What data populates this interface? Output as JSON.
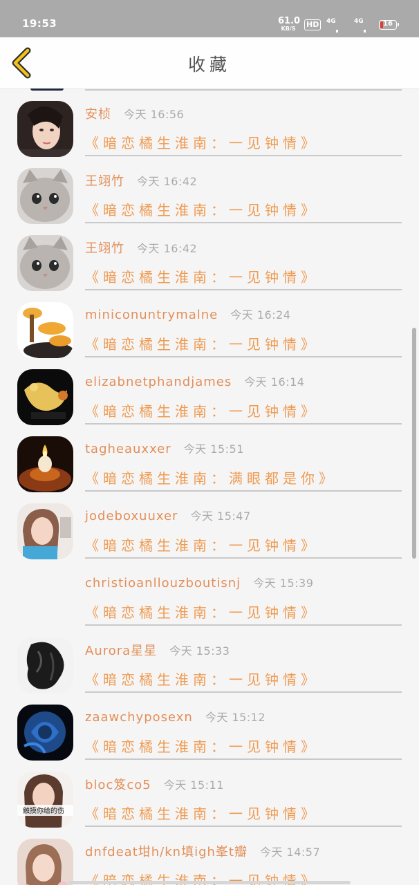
{
  "status_bar": {
    "time": "19:53",
    "speed_value": "61.0",
    "speed_unit": "KB/S",
    "hd": "HD",
    "net1": "4G",
    "net2": "4G",
    "battery": "16"
  },
  "header": {
    "title": "收藏",
    "back_icon": "chevron-left-icon"
  },
  "items": [
    {
      "name": "安桢",
      "time": "今天 16:56",
      "book": "《暗恋橘生淮南：一见钟情》",
      "avatar": "portrait-woman"
    },
    {
      "name": "王翊竹",
      "time": "今天 16:42",
      "book": "《暗恋橘生淮南：一见钟情》",
      "avatar": "cat"
    },
    {
      "name": "王翊竹",
      "time": "今天 16:42",
      "book": "《暗恋橘生淮南：一见钟情》",
      "avatar": "cat"
    },
    {
      "name": "miniconuntrymalne",
      "time": "今天 16:24",
      "book": "《暗恋橘生淮南：一见钟情》",
      "avatar": "mushrooms"
    },
    {
      "name": "elizabnetphandjames",
      "time": "今天 16:14",
      "book": "《暗恋橘生淮南：一见钟情》",
      "avatar": "golden-ornament"
    },
    {
      "name": "tagheauxxer",
      "time": "今天 15:51",
      "book": "《暗恋橘生淮南：满眼都是你》",
      "avatar": "candle"
    },
    {
      "name": "jodeboxuuxer",
      "time": "今天 15:47",
      "book": "《暗恋橘生淮南：一见钟情》",
      "avatar": "girl"
    },
    {
      "name": "christioanllouzboutisnj",
      "time": "今天 15:39",
      "book": "《暗恋橘生淮南：一见钟情》",
      "avatar": "none"
    },
    {
      "name": "Aurora星星",
      "time": "今天 15:33",
      "book": "《暗恋橘生淮南：一见钟情》",
      "avatar": "dark-hair"
    },
    {
      "name": "zaawchyposexn",
      "time": "今天 15:12",
      "book": "《暗恋橘生淮南：一见钟情》",
      "avatar": "blue-rose"
    },
    {
      "name": "bloc笈co5",
      "time": "今天 15:11",
      "book": "《暗恋橘生淮南：一见钟情》",
      "avatar": "woman-caption"
    },
    {
      "name": "dnfdeat坩h/kn填igh峯t瓣",
      "time": "今天 14:57",
      "book": "《暗恋橘生淮南：一见钟情》",
      "avatar": "woman-flowers"
    }
  ],
  "avatar_caption": "触摸你给的伤"
}
